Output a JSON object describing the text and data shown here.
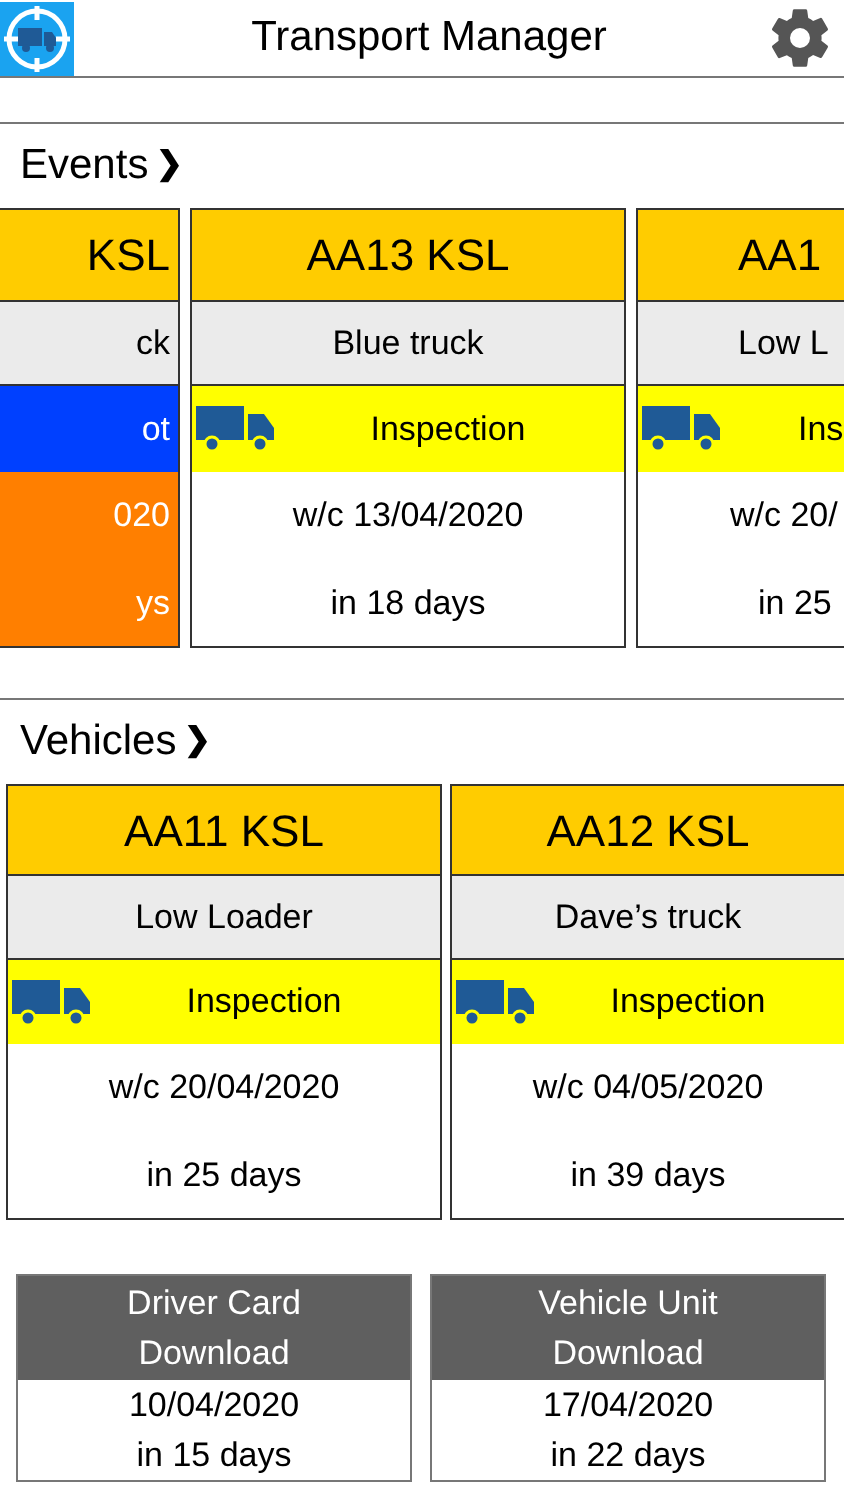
{
  "header": {
    "title": "Transport Manager"
  },
  "events": {
    "title": "Events",
    "chevron": "❯",
    "cards": [
      {
        "registration": "KSL",
        "vehicle": "ck",
        "event": {
          "label": "ot",
          "color": "#0040ff",
          "truck_icon": false
        },
        "overdue": true,
        "date": "020",
        "due": "ys"
      },
      {
        "registration": "AA13 KSL",
        "vehicle": "Blue truck",
        "event": {
          "label": "Inspection",
          "color": "#ffff00",
          "truck_icon": true
        },
        "overdue": false,
        "date": "w/c 13/04/2020",
        "due": "in 18 days"
      },
      {
        "registration": "AA1",
        "vehicle": "Low L",
        "event": {
          "label": "Ins",
          "color": "#ffff00",
          "truck_icon": true
        },
        "overdue": false,
        "date": "w/c 20/",
        "due": "in 25"
      }
    ]
  },
  "vehicles": {
    "title": "Vehicles",
    "chevron": "❯",
    "cards": [
      {
        "registration": "AA11 KSL",
        "vehicle": "Low Loader",
        "event": {
          "label": "Inspection",
          "color": "#ffff00",
          "truck_icon": true
        },
        "overdue": false,
        "date": "w/c 20/04/2020",
        "due": "in 25 days"
      },
      {
        "registration": "AA12 KSL",
        "vehicle": "Dave’s truck",
        "event": {
          "label": "Inspection",
          "color": "#ffff00",
          "truck_icon": true
        },
        "overdue": false,
        "date": "w/c 04/05/2020",
        "due": "in 39 days"
      }
    ]
  },
  "downloads": [
    {
      "title": "Driver Card Download",
      "date": "10/04/2020",
      "due": "in 15 days"
    },
    {
      "title": "Vehicle Unit Download",
      "date": "17/04/2020",
      "due": "in 22 days"
    }
  ]
}
